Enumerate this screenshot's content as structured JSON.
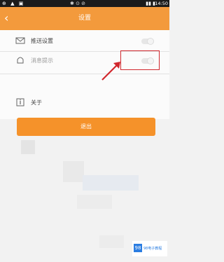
{
  "status_bar": {
    "left_icons": "⊕ ▲ ▣",
    "mid_icons": "✱ ⊙ ⊘",
    "right_icons": "▮▮ ▮",
    "time": "14:50"
  },
  "header": {
    "title": "设置",
    "back_glyph": "‹"
  },
  "settings": {
    "items": [
      {
        "label": "推送设置",
        "icon": "mail-icon",
        "has_toggle": true
      },
      {
        "label": "消息提示",
        "icon": "bell-icon",
        "has_toggle": true
      },
      {
        "label": "关于",
        "icon": "info-icon",
        "has_toggle": false
      }
    ]
  },
  "primary_button": {
    "label": "退出"
  },
  "watermark": {
    "logo": "98",
    "text": "98电子教程"
  },
  "colors": {
    "accent": "#f39a3c",
    "button": "#f5922a",
    "highlight": "#d1282e"
  }
}
